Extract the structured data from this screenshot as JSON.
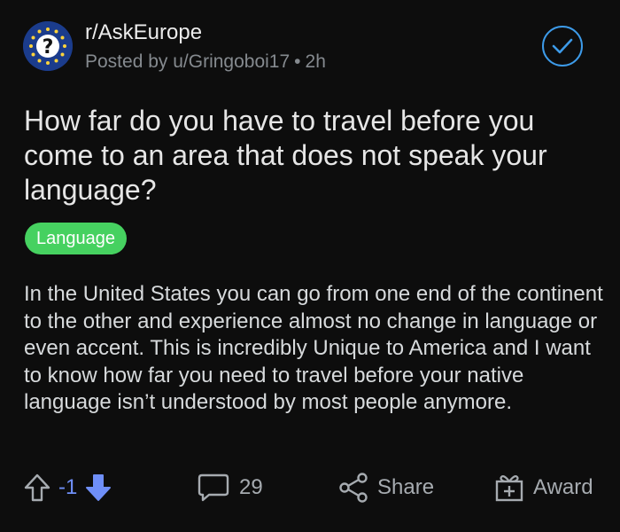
{
  "post": {
    "subreddit": "r/AskEurope",
    "posted_by": "Posted by u/Gringoboi17",
    "separator": "•",
    "age": "2h",
    "title": "How far do you have to travel before you come to an area that does not speak your language?",
    "flair": "Language",
    "body": "In the United States you can go from one end of the continent to the other and experience almost no change in language or even accent.  This is incredibly Unique to America and I want to know how far you need to travel before your native language isn’t understood by most people anymore."
  },
  "actions": {
    "vote_count": "-1",
    "comments": "29",
    "share": "Share",
    "award": "Award"
  },
  "colors": {
    "background": "#0d0d0d",
    "flair": "#46d160",
    "vote_active": "#6f8ff8",
    "joined": "#3d9be9"
  },
  "icons": {
    "avatar": "eu-flag-question-icon",
    "joined": "checkmark-circle-icon",
    "upvote": "arrow-up-outline-icon",
    "downvote": "arrow-down-filled-icon",
    "comments": "speech-bubble-icon",
    "share": "share-nodes-icon",
    "award": "gift-box-icon"
  }
}
